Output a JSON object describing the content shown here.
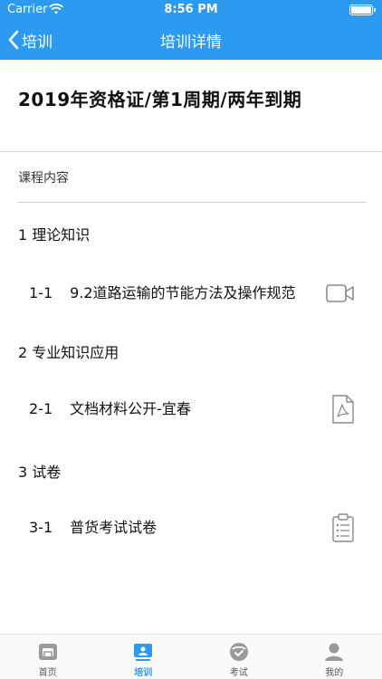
{
  "status_bar": {
    "carrier": "Carrier",
    "time": "8:56 PM"
  },
  "nav": {
    "back_label": "培训",
    "title": "培训详情"
  },
  "course": {
    "title": "2019年资格证/第1周期/两年到期"
  },
  "section": {
    "label": "课程内容"
  },
  "chapters": [
    {
      "label": "1  理论知识",
      "lessons": [
        {
          "code": "1-1",
          "title": "9.2道路运输的节能方法及操作规范",
          "icon": "video-camera-icon"
        }
      ]
    },
    {
      "label": "2  专业知识应用",
      "lessons": [
        {
          "code": "2-1",
          "title": "文档材料公开-宜春",
          "icon": "pdf-document-icon"
        }
      ]
    },
    {
      "label": "3  试卷",
      "lessons": [
        {
          "code": "3-1",
          "title": "普货考试试卷",
          "icon": "clipboard-icon"
        }
      ]
    }
  ],
  "tabbar": {
    "active": "培训",
    "items": [
      {
        "label": "首页",
        "icon": "home-icon"
      },
      {
        "label": "培训",
        "icon": "training-icon"
      },
      {
        "label": "考试",
        "icon": "exam-icon"
      },
      {
        "label": "我的",
        "icon": "profile-icon"
      }
    ]
  },
  "colors": {
    "accent": "#2c9af0",
    "text": "#111111",
    "icon_gray": "#8a8a8a"
  }
}
